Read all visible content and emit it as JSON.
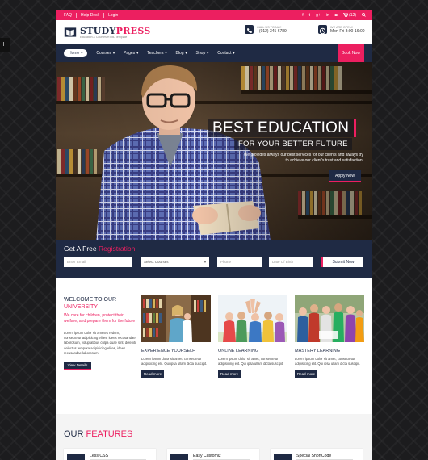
{
  "side_tab": {
    "label": "H"
  },
  "topbar": {
    "links": [
      "FAQ",
      "Help Desk",
      "Login"
    ],
    "social_icons": [
      "facebook-icon",
      "twitter-icon",
      "google-plus-icon",
      "linkedin-icon",
      "instagram-icon"
    ],
    "cart_count": "(12)"
  },
  "header": {
    "logo_part1": "STUDY",
    "logo_part2": "PRESS",
    "logo_tagline": "Education & Courses HTML Template",
    "call_label": "CALL US TODAY!",
    "call_value": "+(012) 345 6789",
    "open_label": "WE ARE OPEN!",
    "open_value": "Mon-Fri 8:00-16:00"
  },
  "nav": {
    "items": [
      "Home",
      "Courses",
      "Pages",
      "Teachers",
      "Blog",
      "Shop",
      "Contact"
    ],
    "book_label": "Book Now"
  },
  "hero": {
    "title": "BEST EDUCATION",
    "subtitle": "FOR YOUR BETTER FUTURE",
    "text": "We provides always our best services for our clients and always try to achieve our client's trust and satisfaction.",
    "button": "Apply Now"
  },
  "registration": {
    "title_part1": "Get A Free ",
    "title_part2": "Registration",
    "title_part3": "!",
    "email_placeholder": "Enter Email",
    "courses_placeholder": "Select Courses",
    "phone_placeholder": "Phone",
    "dob_placeholder": "Date Of Birth",
    "submit": "Submit Now"
  },
  "welcome": {
    "heading1": "WELCOME TO OUR",
    "heading2": "UNIVERSITY",
    "lead": "We care for children, protect their welfare, and prepare them for the future",
    "body": "Lorem ipsum dolor sit ametes redum, consectetur adipisicing elites, idees recusandae laborosum, voluptatibus culpa quae sint, deleniti delectus tempora adipisicing elites, idees recusandae laborosum",
    "button": "View Details"
  },
  "cards": [
    {
      "title": "EXPERIENCE YOURSELF",
      "text": "Lorem ipsum dolor sit amet, consectetur adipisicing elit. Qui ipsa ullam dicta suscipit.",
      "button": "Read more"
    },
    {
      "title": "ONLINE LEARNING",
      "text": "Lorem ipsum dolor sit amet, consectetur adipisicing elit. Qui ipsa ullam dicta suscipit.",
      "button": "Read more"
    },
    {
      "title": "MASTERY LEARNING",
      "text": "Lorem ipsum dolor sit amet, consectetur adipisicing elit. Qui ipsa ullam dicta suscipit.",
      "button": "Read more"
    }
  ],
  "features": {
    "heading1": "OUR ",
    "heading2": "FEATURES",
    "items": [
      "Less CSS",
      "Easy Customiz",
      "Special ShortCode"
    ]
  }
}
